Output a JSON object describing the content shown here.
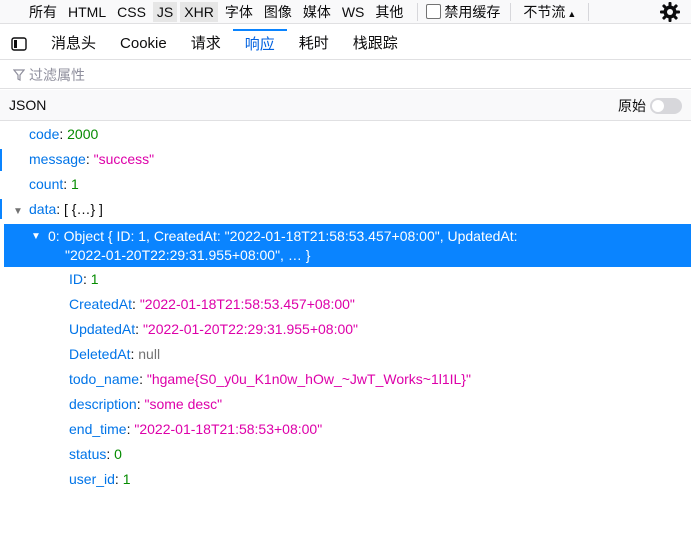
{
  "filter_buttons": [
    {
      "label": "所有",
      "selected": false
    },
    {
      "label": "HTML",
      "selected": false
    },
    {
      "label": "CSS",
      "selected": false
    },
    {
      "label": "JS",
      "selected": true
    },
    {
      "label": "XHR",
      "selected": true
    },
    {
      "label": "字体",
      "selected": false
    },
    {
      "label": "图像",
      "selected": false
    },
    {
      "label": "媒体",
      "selected": false
    },
    {
      "label": "WS",
      "selected": false
    },
    {
      "label": "其他",
      "selected": false
    }
  ],
  "disable_cache": {
    "label": "禁用缓存",
    "checked": false
  },
  "throttling": {
    "label": "不节流"
  },
  "icons": {
    "settings": "gear-icon",
    "panel_toggle": "sidebar-toggle-icon",
    "filter": "funnel-icon"
  },
  "tabs": [
    {
      "label": "消息头",
      "selected": false
    },
    {
      "label": "Cookie",
      "selected": false
    },
    {
      "label": "请求",
      "selected": false
    },
    {
      "label": "响应",
      "selected": true
    },
    {
      "label": "耗时",
      "selected": false
    },
    {
      "label": "栈跟踪",
      "selected": false
    }
  ],
  "filter_input": {
    "placeholder": "过滤属性"
  },
  "json_header": {
    "title": "JSON",
    "raw_label": "原始",
    "raw_on": false
  },
  "colors": {
    "accent": "#0a84ff",
    "key": "#0074e8",
    "string": "#dd00a9",
    "number": "#058b00",
    "null": "#737373"
  },
  "tree": {
    "code": {
      "key": "code",
      "value": "2000"
    },
    "message": {
      "key": "message",
      "value": "\"success\""
    },
    "count": {
      "key": "count",
      "value": "1"
    },
    "data": {
      "key": "data",
      "summary": "[ {…} ]"
    },
    "item0": {
      "key": "0",
      "summary_line1": "Object { ID: 1, CreatedAt: \"2022-01-18T21:58:53.457+08:00\", UpdatedAt:",
      "summary_line2": "\"2022-01-20T22:29:31.955+08:00\", … }"
    },
    "fields": [
      {
        "key": "ID",
        "value": "1",
        "type": "number"
      },
      {
        "key": "CreatedAt",
        "value": "\"2022-01-18T21:58:53.457+08:00\"",
        "type": "string"
      },
      {
        "key": "UpdatedAt",
        "value": "\"2022-01-20T22:29:31.955+08:00\"",
        "type": "string"
      },
      {
        "key": "DeletedAt",
        "value": "null",
        "type": "null"
      },
      {
        "key": "todo_name",
        "value": "\"hgame{S0_y0u_K1n0w_hOw_~JwT_Works~1l1IL}\"",
        "type": "string"
      },
      {
        "key": "description",
        "value": "\"some desc\"",
        "type": "string"
      },
      {
        "key": "end_time",
        "value": "\"2022-01-18T21:58:53+08:00\"",
        "type": "string"
      },
      {
        "key": "status",
        "value": "0",
        "type": "number"
      },
      {
        "key": "user_id",
        "value": "1",
        "type": "number"
      }
    ]
  }
}
